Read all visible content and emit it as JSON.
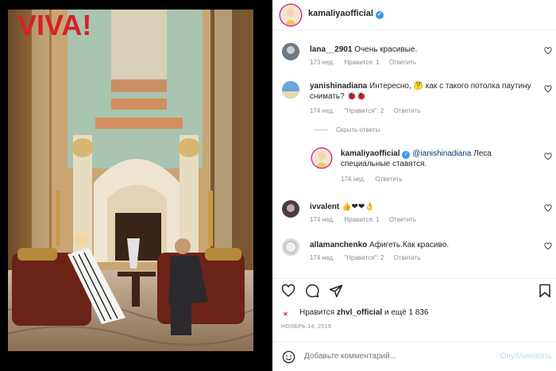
{
  "post": {
    "author": "kamaliyaofficial",
    "photo_logo": "VIVA!"
  },
  "comments": [
    {
      "user": "lana__2901",
      "text": "Очень красивые.",
      "time": "173 нед.",
      "likes": "Нравится: 1",
      "reply": "Ответить"
    },
    {
      "user": "yanishinadiana",
      "text": "Интересно, 🤔 как с такого потолка паутину",
      "text2": "снимать? 🐞🐞",
      "time": "174 нед.",
      "likes": "\"Нравится\": 2",
      "reply": "Ответить"
    },
    {
      "user": "ivvalent",
      "text": "👍❤❤👌",
      "time": "174 нед.",
      "likes": "Нравится: 1",
      "reply": "Ответить"
    },
    {
      "user": "allamanchenko",
      "text": "Афигеть.Как красиво.",
      "time": "174 нед.",
      "likes": "\"Нравится\": 2",
      "reply": "Ответить"
    }
  ],
  "hide_replies": "Скрыть ответы",
  "reply": {
    "user": "kamaliyaofficial",
    "mention": "@ianishinadiana",
    "text": "Леса",
    "text2": "специальные ставятся.",
    "time": "174 нед.",
    "reply": "Ответить"
  },
  "liked_by": {
    "prefix": "Нравится",
    "user": "zhvl_official",
    "suffix": "и ещё 1 836"
  },
  "date": "НОЯБРЬ 14, 2019",
  "add_comment": {
    "placeholder": "Добавьте комментарий...",
    "post_label": "Опубликовать"
  },
  "colors": {
    "accent": "#3897f0",
    "post_button_disabled": "#b2dffc",
    "muted": "#8e8e8e"
  },
  "icons": [
    "heart-icon",
    "comment-icon",
    "share-icon",
    "bookmark-icon",
    "emoji-icon",
    "verified-icon"
  ]
}
